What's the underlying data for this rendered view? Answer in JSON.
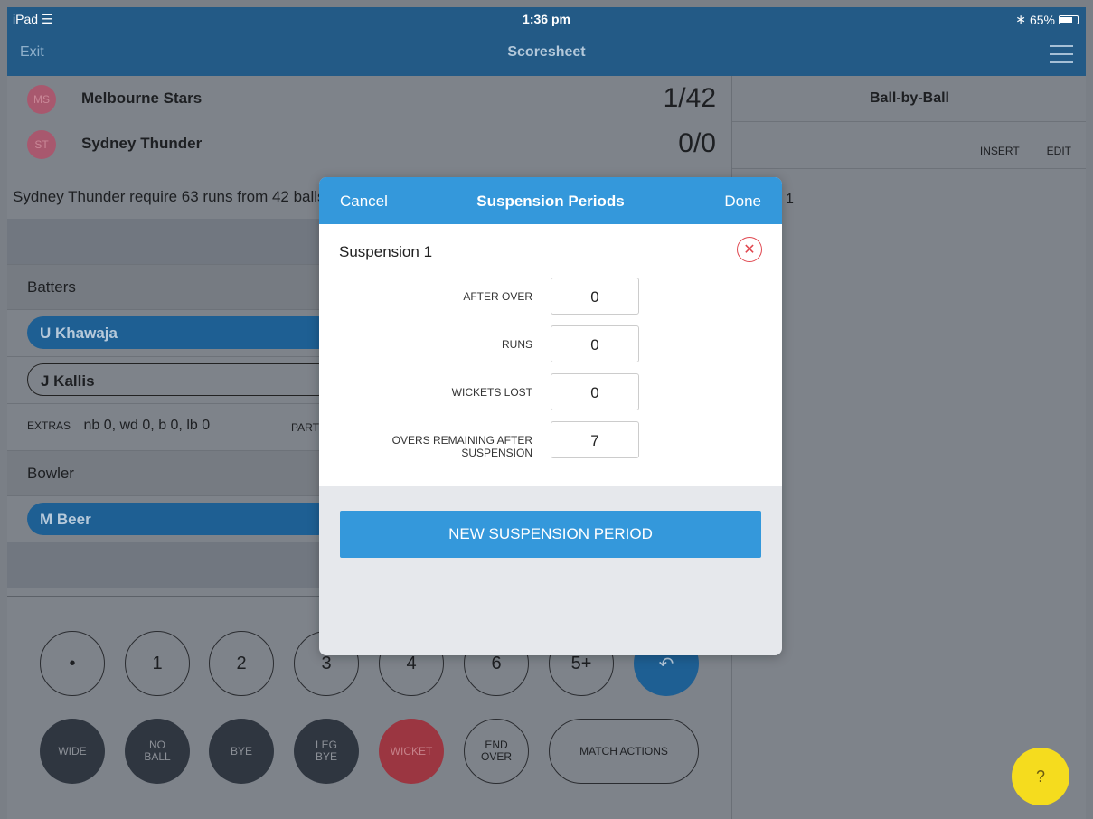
{
  "status_bar": {
    "device": "iPad",
    "wifi_icon": "wifi-icon",
    "time": "1:36 pm",
    "bluetooth_icon": "bluetooth-icon",
    "battery": "65%"
  },
  "nav": {
    "exit_label": "Exit",
    "title": "Scoresheet",
    "menu_icon": "hamburger-menu-icon"
  },
  "teams": [
    {
      "abbr": "MS",
      "name": "Melbourne Stars",
      "score": "1/42"
    },
    {
      "abbr": "ST",
      "name": "Sydney Thunder",
      "score": "0/0"
    }
  ],
  "requirement": "Sydney Thunder require 63 runs from 42 balls",
  "batters": {
    "heading": "Batters",
    "players": [
      "U Khawaja",
      "J Kallis"
    ]
  },
  "extras": {
    "label": "EXTRAS",
    "value": "nb 0, wd 0, b 0, lb 0",
    "partnership_label": "PARTN"
  },
  "bowler": {
    "heading": "Bowler",
    "player": "M Beer"
  },
  "keypad": {
    "runs": [
      "•",
      "1",
      "2",
      "3",
      "4",
      "6",
      "5+"
    ],
    "undo_icon": "undo-icon",
    "wide": "WIDE",
    "no_ball": [
      "NO",
      "BALL"
    ],
    "bye": "BYE",
    "leg_bye": [
      "LEG",
      "BYE"
    ],
    "wicket": "WICKET",
    "end_over": [
      "END",
      "OVER"
    ],
    "match_actions": "MATCH ACTIONS"
  },
  "ball_by_ball": {
    "title": "Ball-by-Ball",
    "insert": "INSERT",
    "edit": "EDIT",
    "over_number": "1"
  },
  "help": {
    "label": "?"
  },
  "modal": {
    "cancel": "Cancel",
    "title": "Suspension Periods",
    "done": "Done",
    "suspension_title": "Suspension 1",
    "close_icon": "close-circle-icon",
    "fields": [
      {
        "label": "AFTER OVER",
        "value": "0"
      },
      {
        "label": "RUNS",
        "value": "0"
      },
      {
        "label": "WICKETS LOST",
        "value": "0"
      },
      {
        "label": "OVERS REMAINING AFTER SUSPENSION",
        "value": "7"
      }
    ],
    "new_button": "NEW SUSPENSION PERIOD"
  },
  "colors": {
    "nav_blue": "#235a86",
    "modal_blue": "#3498db",
    "danger_red": "#e0474f",
    "help_yellow": "#f5dc1e"
  }
}
